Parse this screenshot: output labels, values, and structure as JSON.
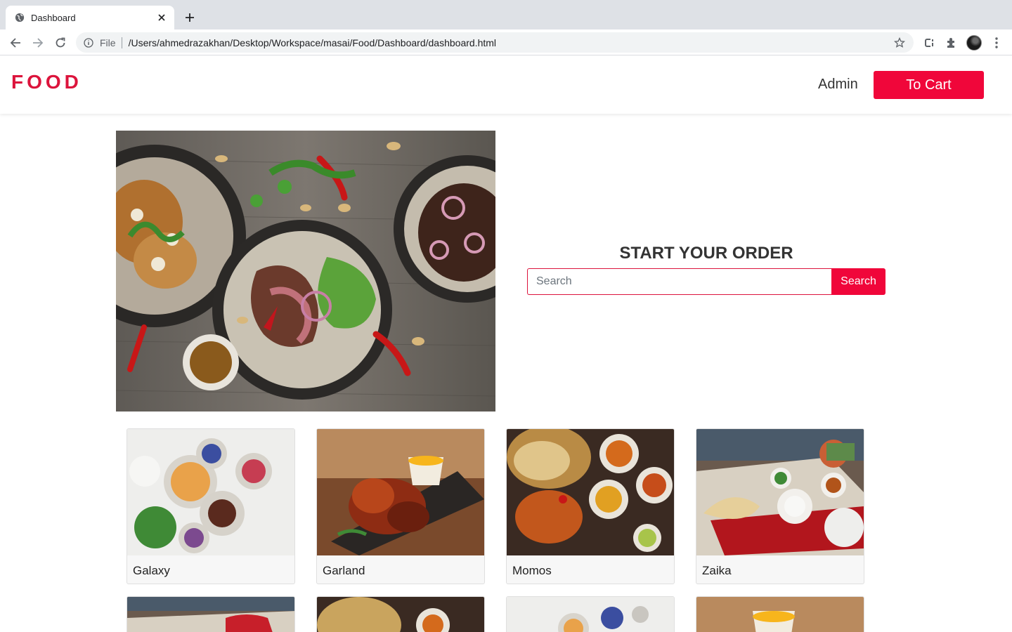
{
  "browser": {
    "tab_title": "Dashboard",
    "scheme": "File",
    "url": "/Users/ahmedrazakhan/Desktop/Workspace/masai/Food/Dashboard/dashboard.html"
  },
  "navbar": {
    "brand": "FOOD",
    "admin_label": "Admin",
    "cart_label": "To Cart"
  },
  "hero": {
    "heading": "START YOUR ORDER",
    "search_placeholder": "Search",
    "search_button": "Search"
  },
  "restaurants": [
    {
      "name": "Galaxy"
    },
    {
      "name": "Garland"
    },
    {
      "name": "Momos"
    },
    {
      "name": "Zaika"
    }
  ],
  "colors": {
    "brand": "#dc143c",
    "button": "#f0063a"
  }
}
